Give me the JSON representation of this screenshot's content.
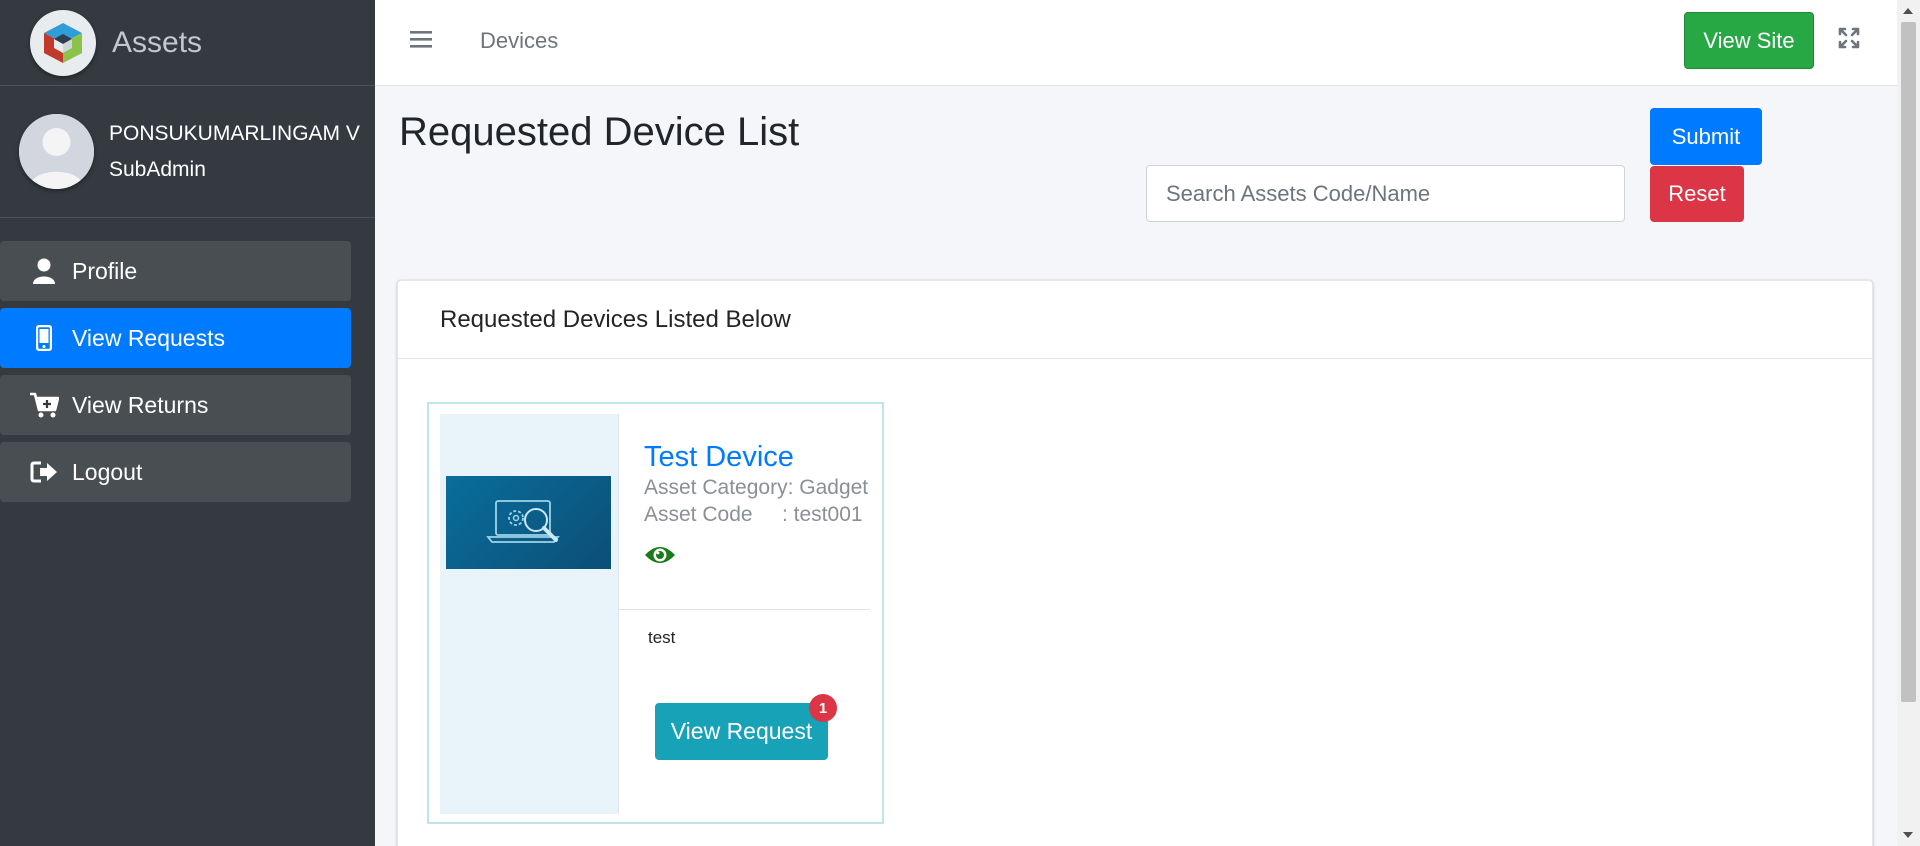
{
  "sidebar": {
    "brand": "Assets",
    "user": {
      "name": "PONSUKUMARLINGAM V",
      "role": "SubAdmin"
    },
    "items": [
      {
        "label": "Profile",
        "icon": "user-icon"
      },
      {
        "label": "View Requests",
        "icon": "mobile-icon"
      },
      {
        "label": "View Returns",
        "icon": "cart-plus-icon"
      },
      {
        "label": "Logout",
        "icon": "sign-out-icon"
      }
    ],
    "active_index": 1
  },
  "header": {
    "crumb": "Devices",
    "view_site": "View Site"
  },
  "page": {
    "title": "Requested Device List",
    "search_placeholder": "Search Assets Code/Name",
    "submit": "Submit",
    "reset": "Reset",
    "card_header": "Requested Devices Listed Below"
  },
  "devices": [
    {
      "name": "Test Device",
      "category_label": "Asset Category:",
      "category": "Gadget",
      "code_label": "Asset Code",
      "code": ": test001",
      "description": "test",
      "action": "View Request",
      "badge": "1"
    }
  ],
  "colors": {
    "sidebar_bg": "#343a40",
    "active": "#007bff",
    "success": "#28a745",
    "danger": "#dc3545",
    "info": "#17a2b8"
  }
}
